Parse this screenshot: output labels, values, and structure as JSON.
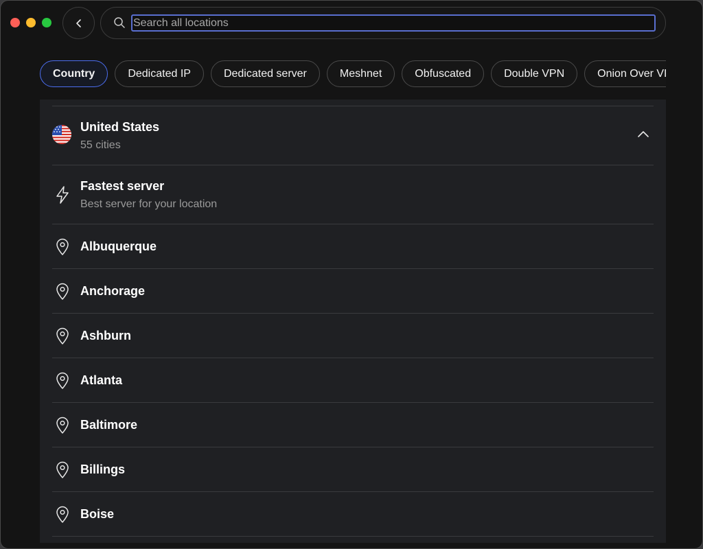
{
  "search": {
    "placeholder": "Search all locations",
    "value": ""
  },
  "filters": [
    {
      "label": "Country",
      "active": true
    },
    {
      "label": "Dedicated IP",
      "active": false
    },
    {
      "label": "Dedicated server",
      "active": false
    },
    {
      "label": "Meshnet",
      "active": false
    },
    {
      "label": "Obfuscated",
      "active": false
    },
    {
      "label": "Double VPN",
      "active": false
    },
    {
      "label": "Onion Over VPN",
      "active": false
    }
  ],
  "country": {
    "name": "United States",
    "subtitle": "55 cities",
    "flag_icon": "us-flag-icon"
  },
  "fastest": {
    "title": "Fastest server",
    "subtitle": "Best server for your location",
    "icon": "lightning-icon"
  },
  "cities": [
    "Albuquerque",
    "Anchorage",
    "Ashburn",
    "Atlanta",
    "Baltimore",
    "Billings",
    "Boise"
  ],
  "colors": {
    "accent": "#4c6ef0",
    "panel": "#1f2023",
    "background": "#141414"
  }
}
